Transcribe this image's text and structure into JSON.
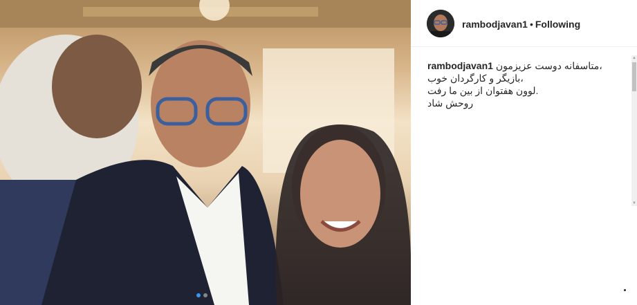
{
  "header": {
    "username": "rambodjavan1",
    "separator": "•",
    "follow_status": "Following"
  },
  "caption": {
    "username": "rambodjavan1",
    "lines": [
      "متاسفانه دوست عزیزمون،",
      "بازیگر و کارگردان خوب،",
      "لوون هفتوان از بین ما رفت.",
      "روحش شاد"
    ]
  },
  "photo": {
    "description_icon": "selfie-photo",
    "carousel": {
      "count": 2,
      "active_index": 0
    }
  },
  "colors": {
    "text": "#262626",
    "active_dot": "#3897f0",
    "border": "#efefef"
  }
}
